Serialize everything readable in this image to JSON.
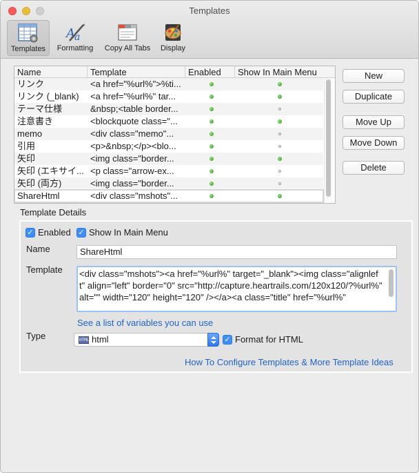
{
  "window": {
    "title": "Templates"
  },
  "toolbar": {
    "items": [
      {
        "label": "Templates",
        "icon": "templates-grid-icon",
        "active": true
      },
      {
        "label": "Formatting",
        "icon": "pen-aa-icon",
        "active": false
      },
      {
        "label": "Copy All Tabs",
        "icon": "browser-tabs-icon",
        "active": false
      },
      {
        "label": "Display",
        "icon": "paint-palette-icon",
        "active": false
      }
    ]
  },
  "table": {
    "columns": [
      "Name",
      "Template",
      "Enabled",
      "Show In Main Menu"
    ],
    "rows": [
      {
        "name": "リンク",
        "template": "<a href=\"%url%\">%ti...",
        "enabled": true,
        "show_in_menu": true
      },
      {
        "name": "リンク (_blank)",
        "template": "<a href=\"%url%\" tar...",
        "enabled": true,
        "show_in_menu": true
      },
      {
        "name": "テーマ仕様",
        "template": "&nbsp;<table border...",
        "enabled": true,
        "show_in_menu": false
      },
      {
        "name": "注意書き",
        "template": "<blockquote class=\"...",
        "enabled": true,
        "show_in_menu": true
      },
      {
        "name": "memo",
        "template": "<div class=\"memo\"...",
        "enabled": true,
        "show_in_menu": false
      },
      {
        "name": "引用",
        "template": "<p>&nbsp;</p><blo...",
        "enabled": true,
        "show_in_menu": false
      },
      {
        "name": "矢印",
        "template": "<img class=\"border...",
        "enabled": true,
        "show_in_menu": true
      },
      {
        "name": "矢印 (エキサイ...",
        "template": "<p class=\"arrow-ex...",
        "enabled": true,
        "show_in_menu": false
      },
      {
        "name": "矢印 (両方)",
        "template": "<img class=\"border...",
        "enabled": true,
        "show_in_menu": false
      },
      {
        "name": "ShareHtml",
        "template": "<div class=\"mshots\"...",
        "enabled": true,
        "show_in_menu": true,
        "selected": true
      }
    ]
  },
  "buttons": {
    "new": "New",
    "duplicate": "Duplicate",
    "move_up": "Move Up",
    "move_down": "Move Down",
    "delete": "Delete"
  },
  "details": {
    "section_title": "Template Details",
    "enabled_label": "Enabled",
    "enabled_checked": true,
    "show_in_menu_label": "Show In Main Menu",
    "show_in_menu_checked": true,
    "name_label": "Name",
    "name_value": "ShareHtml",
    "template_label": "Template",
    "template_value": "<div class=\"mshots\"><a href=\"%url%\" target=\"_blank\"><img class=\"alignleft\" align=\"left\" border=\"0\" src=\"http://capture.heartrails.com/120x120/?%url%\" alt=\"\" width=\"120\" height=\"120\" /></a><a class=\"title\" href=\"%url%\"",
    "variables_link": "See a list of variables you can use",
    "type_label": "Type",
    "type_value": "html",
    "type_icon_text": "HTML",
    "format_html_label": "Format for HTML",
    "format_html_checked": true,
    "help_link": "How To Configure Templates & More Template Ideas"
  },
  "colors": {
    "accent": "#3f8ef7",
    "link": "#1f62c9",
    "enabled_dot": "#2f9a1a"
  }
}
